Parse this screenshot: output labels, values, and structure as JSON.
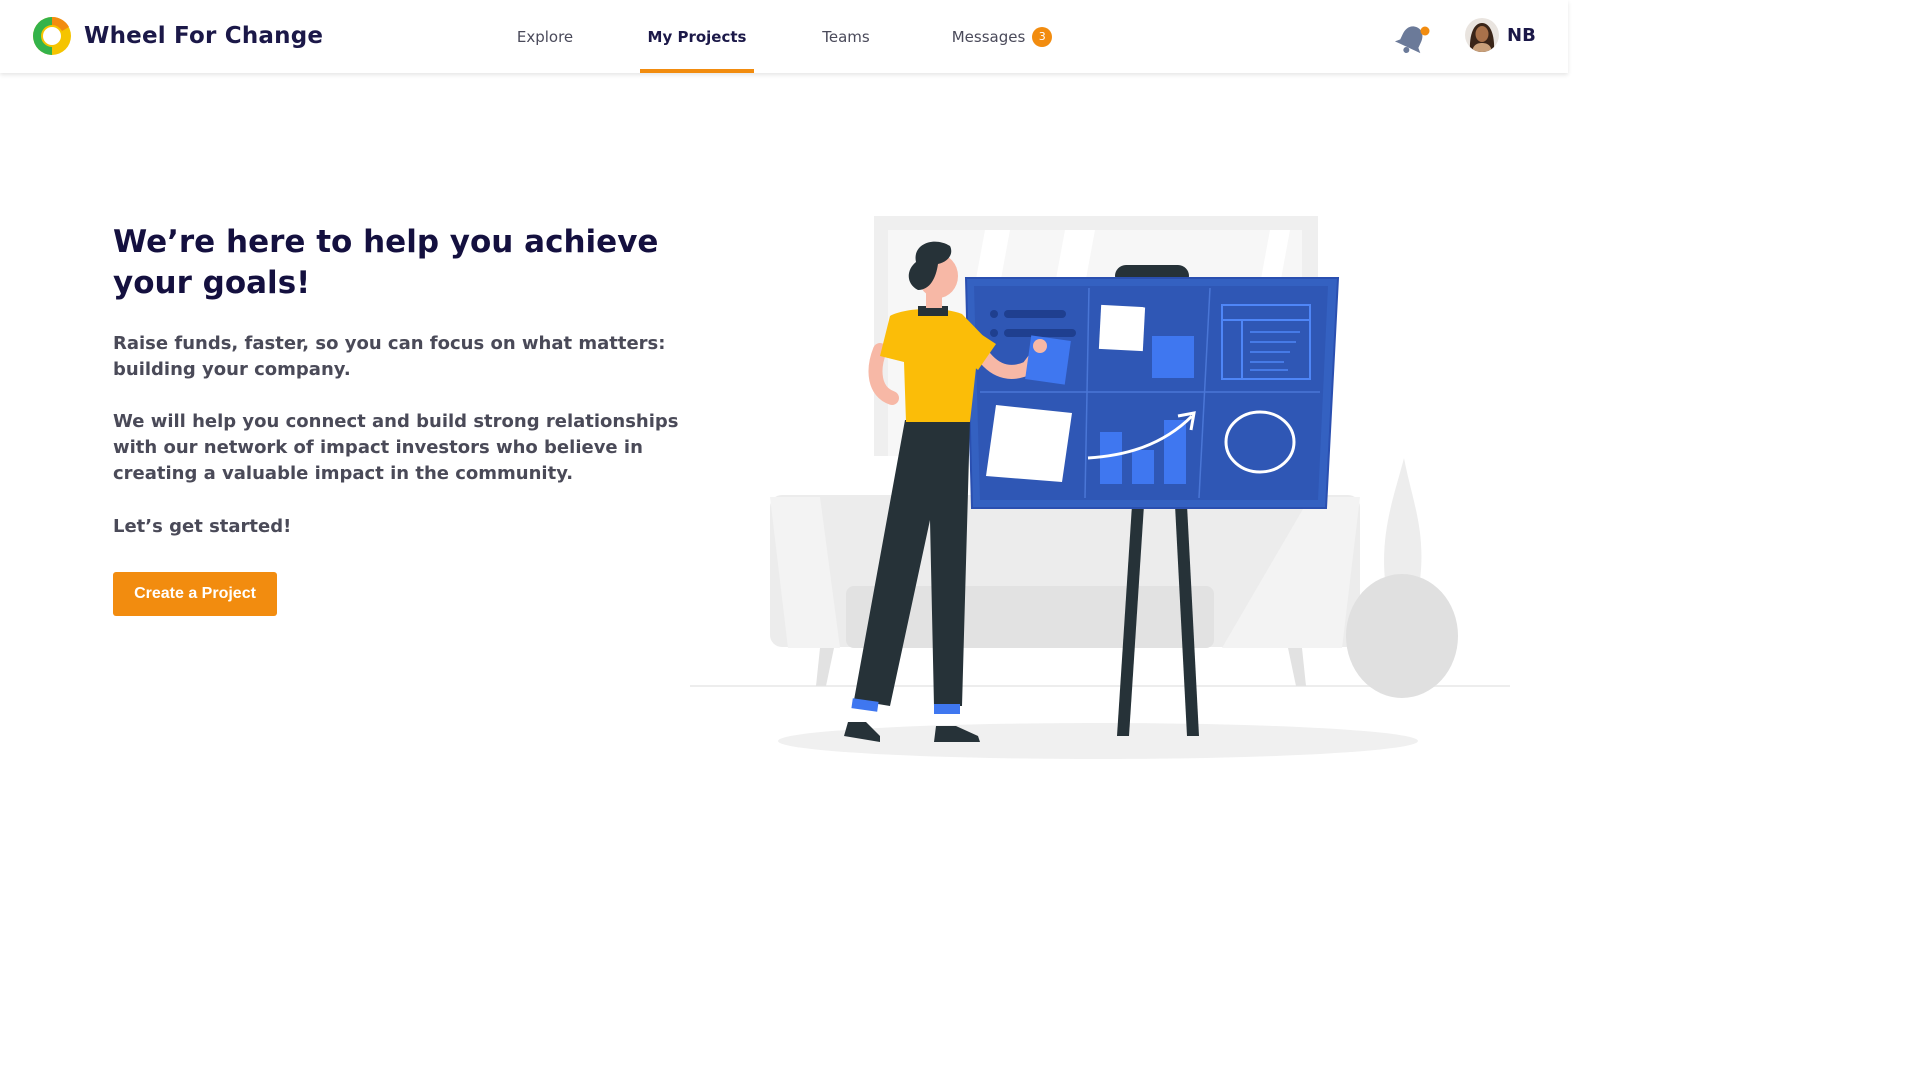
{
  "header": {
    "brand_name": "Wheel For Change",
    "nav": [
      {
        "label": "Explore",
        "active": false
      },
      {
        "label": "My Projects",
        "active": true
      },
      {
        "label": "Teams",
        "active": false
      },
      {
        "label": "Messages",
        "active": false,
        "badge": "3"
      }
    ],
    "notification_icon": "bell-icon",
    "user_initials": "NB"
  },
  "hero": {
    "title": "We’re here to help you achieve your goals!",
    "paragraph_1": "Raise funds, faster, so you can focus on what matters: building your company.",
    "paragraph_2": "We will help you connect and build strong relationships with our network of impact investors who believe in creating a valuable impact in the community.",
    "paragraph_3": "Let’s get started!",
    "cta_label": "Create a Project"
  },
  "colors": {
    "accent": "#f28c0f",
    "brand_dark": "#1b1848",
    "board_blue": "#3461c1",
    "shirt_yellow": "#fbbd08"
  }
}
